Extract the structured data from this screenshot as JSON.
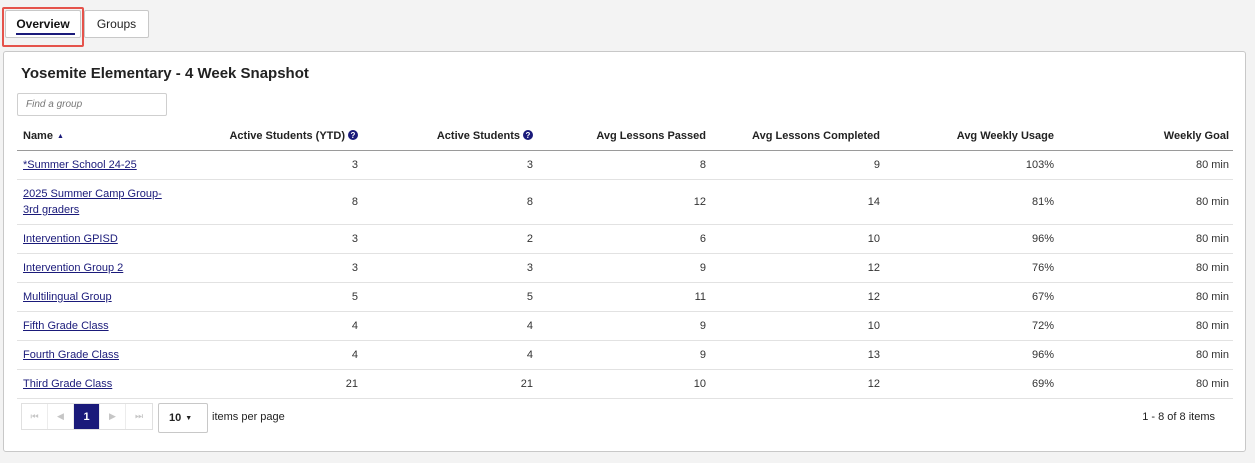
{
  "tabs": {
    "overview": "Overview",
    "groups": "Groups"
  },
  "panel": {
    "title": "Yosemite Elementary - 4 Week Snapshot",
    "search_placeholder": "Find a group"
  },
  "table": {
    "headers": {
      "name": "Name",
      "active_ytd": "Active Students (YTD)",
      "active": "Active Students",
      "avg_passed": "Avg Lessons Passed",
      "avg_completed": "Avg Lessons Completed",
      "avg_usage": "Avg Weekly Usage",
      "weekly_goal": "Weekly Goal"
    },
    "sort": {
      "column": "name",
      "direction": "ascending",
      "icon": "sort-ascending-icon"
    },
    "rows": [
      {
        "name": "*Summer School 24-25",
        "active_ytd": "3",
        "active": "3",
        "avg_passed": "8",
        "avg_completed": "9",
        "avg_usage": "103%",
        "weekly_goal": "80 min"
      },
      {
        "name": "2025 Summer Camp Group-3rd graders",
        "active_ytd": "8",
        "active": "8",
        "avg_passed": "12",
        "avg_completed": "14",
        "avg_usage": "81%",
        "weekly_goal": "80 min"
      },
      {
        "name": "Intervention GPISD",
        "active_ytd": "3",
        "active": "2",
        "avg_passed": "6",
        "avg_completed": "10",
        "avg_usage": "96%",
        "weekly_goal": "80 min"
      },
      {
        "name": "Intervention Group 2",
        "active_ytd": "3",
        "active": "3",
        "avg_passed": "9",
        "avg_completed": "12",
        "avg_usage": "76%",
        "weekly_goal": "80 min"
      },
      {
        "name": "Multilingual Group",
        "active_ytd": "5",
        "active": "5",
        "avg_passed": "11",
        "avg_completed": "12",
        "avg_usage": "67%",
        "weekly_goal": "80 min"
      },
      {
        "name": "Fifth Grade Class",
        "active_ytd": "4",
        "active": "4",
        "avg_passed": "9",
        "avg_completed": "10",
        "avg_usage": "72%",
        "weekly_goal": "80 min"
      },
      {
        "name": "Fourth Grade Class",
        "active_ytd": "4",
        "active": "4",
        "avg_passed": "9",
        "avg_completed": "13",
        "avg_usage": "96%",
        "weekly_goal": "80 min"
      },
      {
        "name": "Third Grade Class",
        "active_ytd": "21",
        "active": "21",
        "avg_passed": "10",
        "avg_completed": "12",
        "avg_usage": "69%",
        "weekly_goal": "80 min"
      }
    ]
  },
  "pager": {
    "first": "⏮",
    "prev": "◀",
    "current_page": "1",
    "next": "▶",
    "last": "⏭",
    "per_page": "10",
    "per_page_label": "items per page",
    "range": "1 - 8 of 8 items"
  },
  "colors": {
    "accent": "#1a1a7a",
    "highlight": "#e5534b"
  }
}
